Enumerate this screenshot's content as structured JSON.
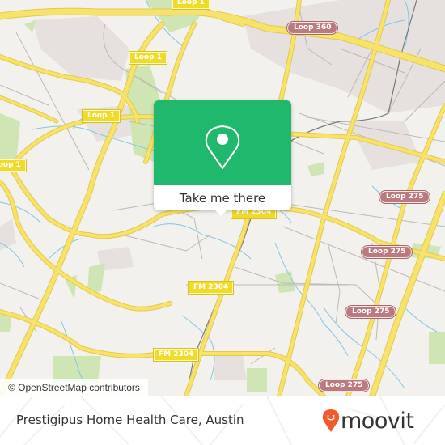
{
  "map": {
    "colors": {
      "background": "#f2f1ed",
      "major_road": "#f7e36b",
      "major_road_casing": "#e5c94a",
      "minor_road": "#bdbab5",
      "water": "#7ec7e6",
      "park": "#cfe6b4",
      "urban": "#e6e0de",
      "rail": "#777777"
    },
    "shields": [
      {
        "label": "Loop 1",
        "style": "yellow"
      },
      {
        "label": "Loop 1",
        "style": "yellow"
      },
      {
        "label": "Loop 1",
        "style": "yellow"
      },
      {
        "label": "Loop 1",
        "style": "yellow"
      },
      {
        "label": "Loop 360",
        "style": "loop"
      },
      {
        "label": "Loop 275",
        "style": "loop"
      },
      {
        "label": "Loop 275",
        "style": "loop"
      },
      {
        "label": "Loop 275",
        "style": "loop"
      },
      {
        "label": "Loop 275",
        "style": "loop"
      },
      {
        "label": "FM 2304",
        "style": "yellow"
      },
      {
        "label": "FM 2304",
        "style": "yellow"
      },
      {
        "label": "FM 2304",
        "style": "yellow"
      }
    ],
    "attribution": "© OpenStreetMap contributors"
  },
  "popup": {
    "icon": "location-pin-icon",
    "button_label": "Take me there",
    "accent_color": "#1fb86c"
  },
  "footer": {
    "place_name": "Prestigipus Home Health Care, Austin",
    "brand": "moovit",
    "brand_color": "#f15a2b"
  }
}
